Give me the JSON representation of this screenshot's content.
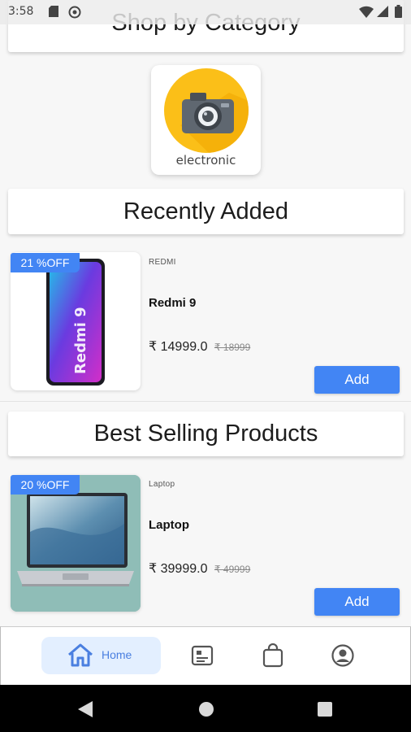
{
  "status_bar": {
    "time": "3:58"
  },
  "sections": {
    "shop_by_category": "Shop by Category",
    "recently_added": "Recently Added",
    "best_selling": "Best Selling Products"
  },
  "category": {
    "label": "electronic",
    "icon": "camera-icon"
  },
  "recent_product": {
    "badge": "21 %OFF",
    "brand": "REDMI",
    "name": "Redmi 9",
    "price": "₹ 14999.0",
    "mrp": "₹ 18999",
    "add_label": "Add"
  },
  "best_product": {
    "badge": "20 %OFF",
    "brand": "Laptop",
    "name": "Laptop",
    "price": "₹ 39999.0",
    "mrp": "₹ 49999",
    "add_label": "Add"
  },
  "bottom_nav": {
    "home_label": "Home",
    "items": [
      "home-icon",
      "orders-icon",
      "bag-icon",
      "profile-icon"
    ]
  },
  "colors": {
    "accent": "#4285f4",
    "camera_bg": "#fbbf18",
    "nav_active_bg": "#e3efff"
  }
}
